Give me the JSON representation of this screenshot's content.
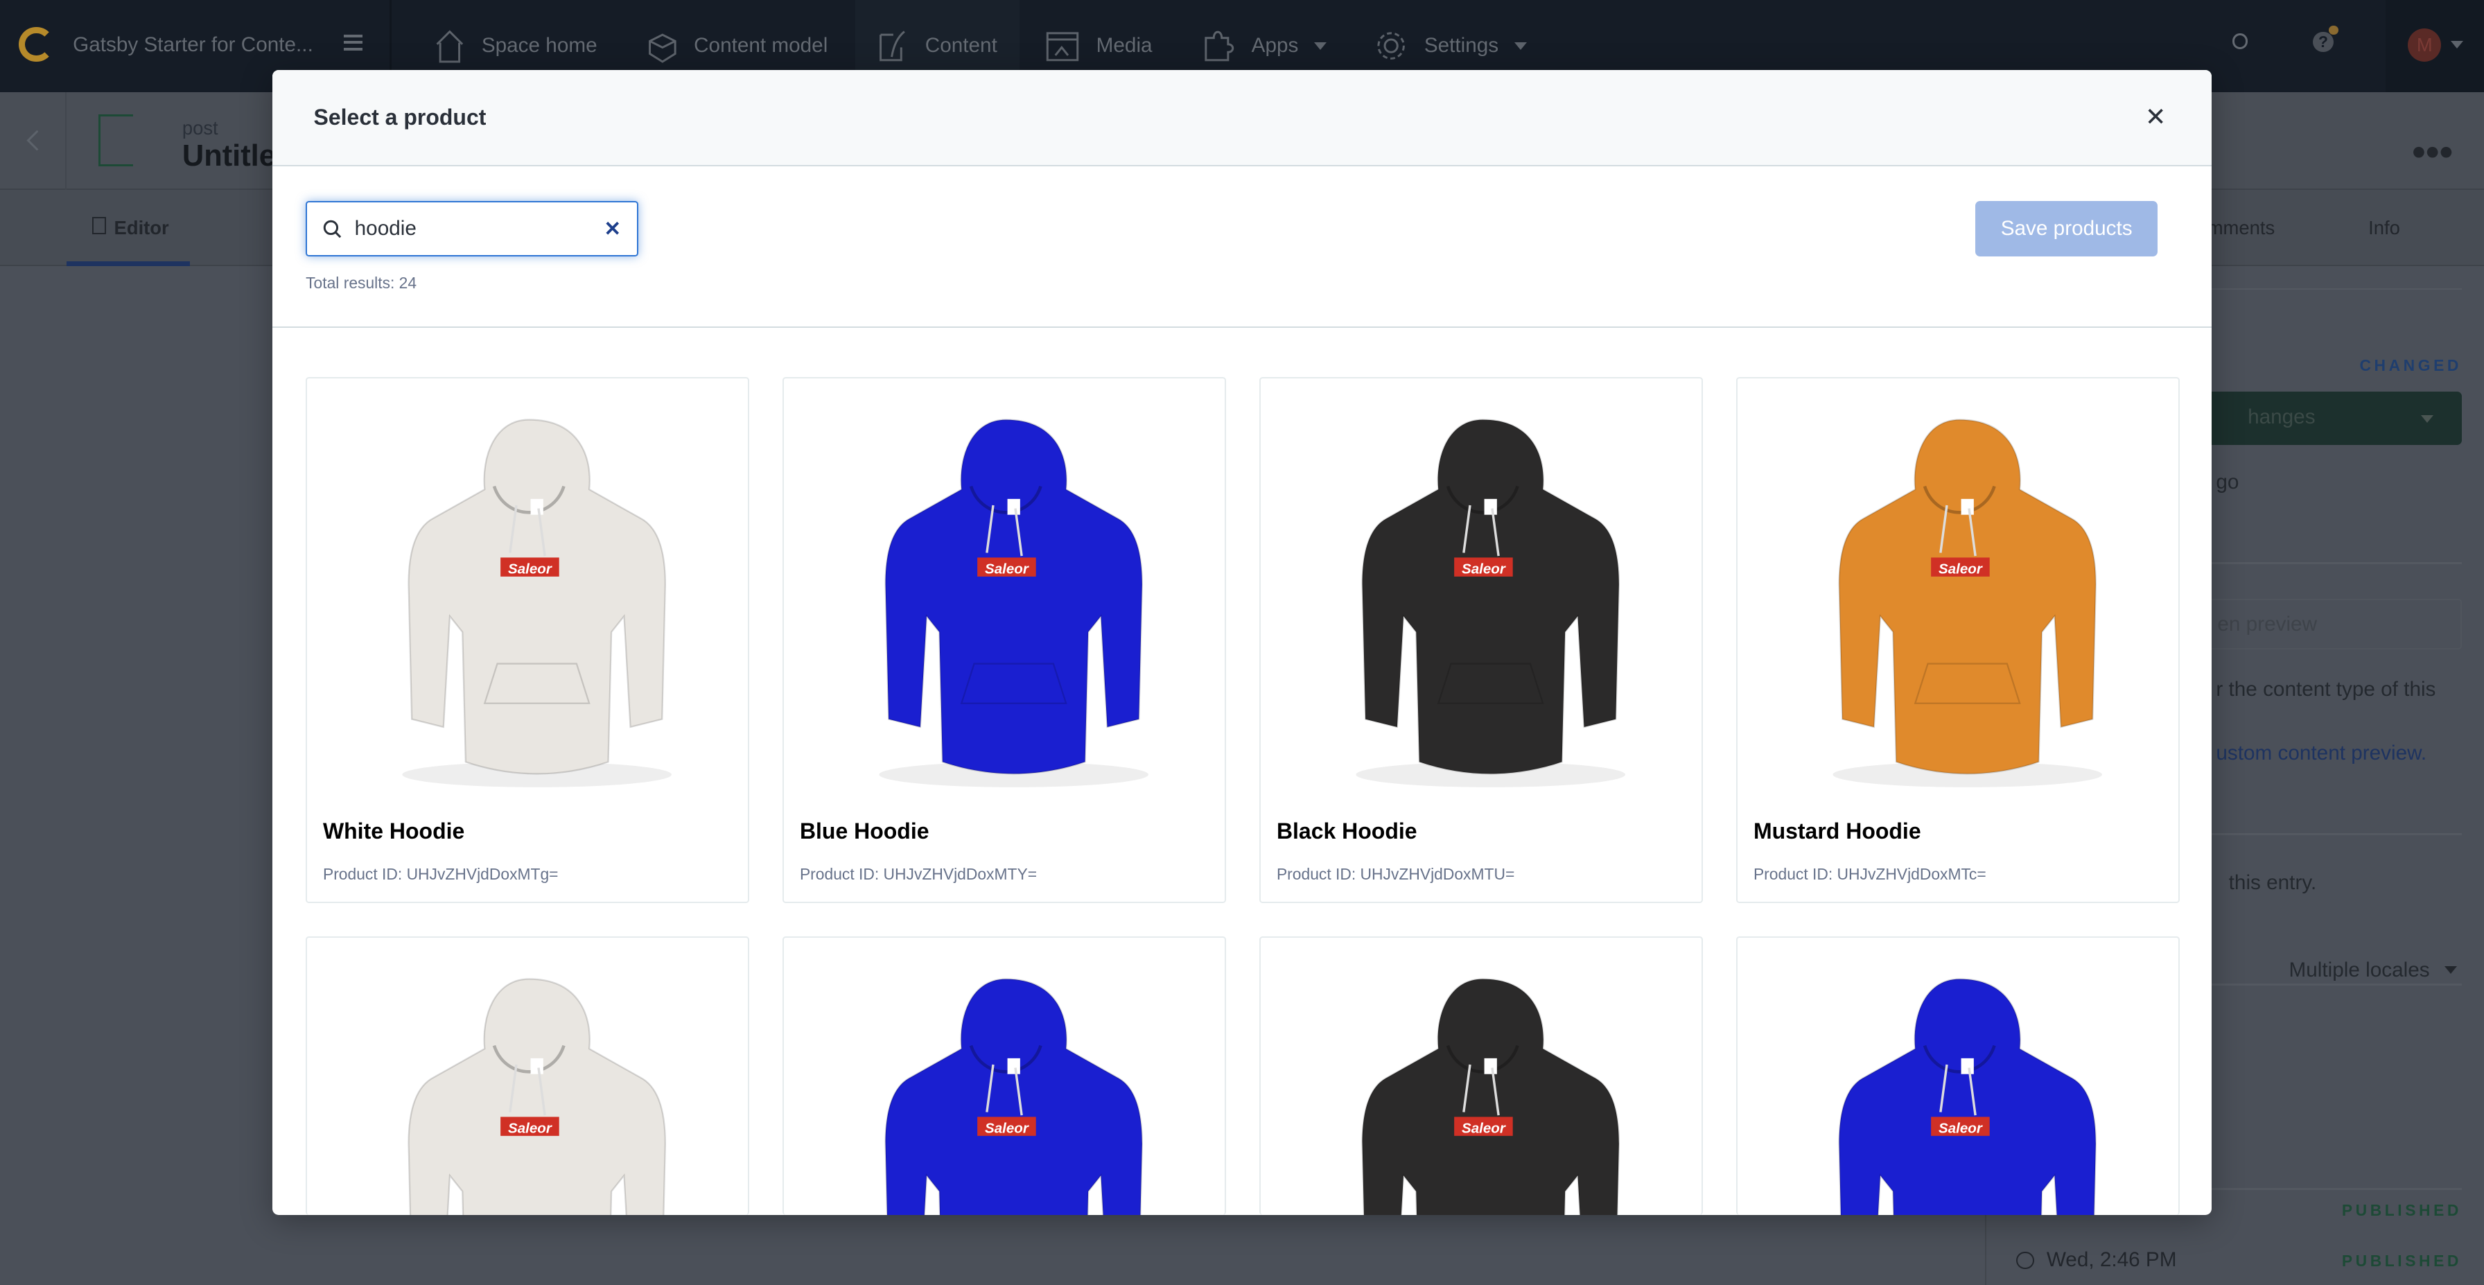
{
  "topnav": {
    "space_name": "Gatsby Starter for Conte...",
    "items": [
      {
        "label": "Space home",
        "icon": "home-icon"
      },
      {
        "label": "Content model",
        "icon": "content-model-icon"
      },
      {
        "label": "Content",
        "icon": "content-icon"
      },
      {
        "label": "Media",
        "icon": "media-icon"
      },
      {
        "label": "Apps",
        "icon": "puzzle-icon"
      },
      {
        "label": "Settings",
        "icon": "gear-icon"
      }
    ],
    "avatar_initial": "M"
  },
  "entry": {
    "content_type": "post",
    "title": "Untitle",
    "tab_editor": "Editor",
    "tab_comments": "Comments",
    "tab_info": "Info"
  },
  "sidebar": {
    "status": "CHANGED",
    "publish_fragment": "hanges",
    "time_fragment": "go",
    "preview_fragment": "en preview",
    "preview_text_fragment": "r the content type of this",
    "preview_link_fragment": "ustom content preview.",
    "entry_fragment": "this entry.",
    "locales": "Multiple locales",
    "published1": "PUBLISHED",
    "published2": "PUBLISHED",
    "version_time": "Wed, 2:46 PM",
    "colors": {
      "changed": "#1f3e6e",
      "published": "#1d4a36",
      "publish_button": "#1c302d"
    }
  },
  "modal": {
    "title": "Select a product",
    "search_value": "hoodie",
    "save_label": "Save products",
    "total_results": "Total results: 24",
    "brand_label": "Saleor",
    "products": [
      {
        "name": "White Hoodie",
        "id": "Product ID: UHJvZHVjdDoxMTg=",
        "color": "#e9e6e1"
      },
      {
        "name": "Blue Hoodie",
        "id": "Product ID: UHJvZHVjdDoxMTY=",
        "color": "#1a1fd0"
      },
      {
        "name": "Black Hoodie",
        "id": "Product ID: UHJvZHVjdDoxMTU=",
        "color": "#2b2a2a"
      },
      {
        "name": "Mustard Hoodie",
        "id": "Product ID: UHJvZHVjdDoxMTc=",
        "color": "#e08a2c"
      },
      {
        "color": "#e9e6e1"
      },
      {
        "color": "#1a1fd0"
      },
      {
        "color": "#2b2a2a"
      },
      {
        "color": "#1a1fd0"
      }
    ]
  }
}
